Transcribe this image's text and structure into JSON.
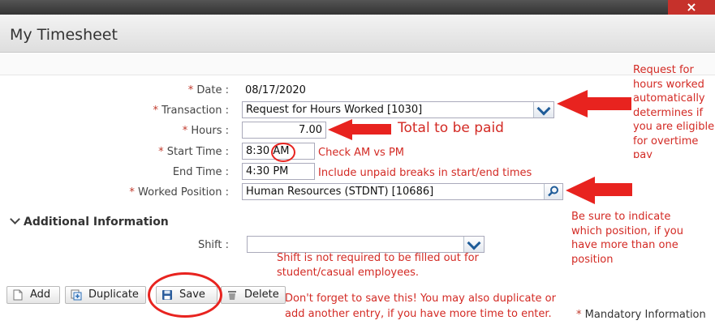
{
  "window": {
    "close_label": "×",
    "title": "My Timesheet"
  },
  "form": {
    "date_label": "Date :",
    "date_value": "08/17/2020",
    "transaction_label": "Transaction :",
    "transaction_value": "Request for Hours Worked [1030]",
    "hours_label": "Hours :",
    "hours_value": "7.00",
    "start_label": "Start Time :",
    "start_value": "8:30 AM",
    "end_label": "End Time :",
    "end_value": "4:30 PM",
    "position_label": "Worked Position :",
    "position_value": "Human Resources (STDNT) [10686]",
    "required_mark": "*",
    "additional_label": "Additional Information",
    "shift_label": "Shift :",
    "shift_value": ""
  },
  "annotations": {
    "overtime": [
      "Request for",
      "hours worked",
      "automatically",
      "determines if",
      "you are eligible",
      "for overtime",
      "pay"
    ],
    "total": "Total to be paid",
    "ampm": "Check AM vs PM",
    "breaks": "Include unpaid breaks in start/end times",
    "position": [
      "Be sure to indicate",
      "which position, if you",
      "have more than one",
      "position"
    ],
    "shift": [
      "Shift is not required to be filled out for",
      "student/casual employees."
    ],
    "save": [
      "Don't forget to save this! You may also duplicate or",
      "add another entry, if you have more time to enter."
    ]
  },
  "buttons": {
    "add": "Add",
    "duplicate": "Duplicate",
    "save": "Save",
    "delete": "Delete"
  },
  "footer": {
    "mandatory_mark": "*",
    "mandatory_label": "Mandatory Information"
  },
  "colors": {
    "annotation": "#e8231f",
    "required": "#c0392b",
    "accent": "#1f5c99"
  }
}
